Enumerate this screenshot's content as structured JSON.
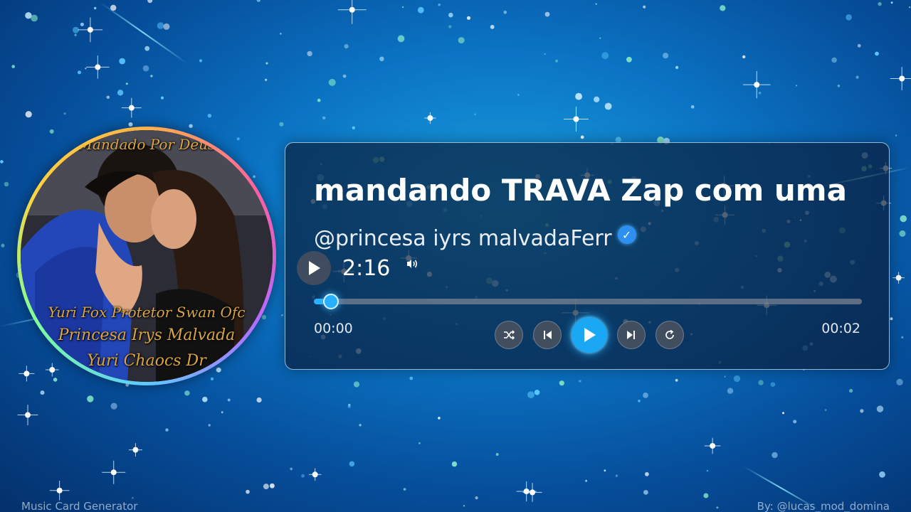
{
  "song": {
    "title": "mandando TRAVA Zap com uma ...",
    "artist": "@princesa iyrs malvadaFerr",
    "verified_icon": "verified-badge-icon",
    "duration": "2:16"
  },
  "player": {
    "current_time": "00:00",
    "total_time": "00:02",
    "progress": 0.02,
    "controls": [
      {
        "name": "shuffle-button",
        "icon": "shuffle-icon"
      },
      {
        "name": "previous-button",
        "icon": "skip-previous-icon"
      },
      {
        "name": "play-button",
        "icon": "play-icon"
      },
      {
        "name": "next-button",
        "icon": "skip-next-icon"
      },
      {
        "name": "repeat-button",
        "icon": "repeat-icon"
      }
    ],
    "accent_color": "#1aa8f5"
  },
  "cover": {
    "overlay_lines": [
      "Mandado Por Deus",
      "Yuri Fox Protetor Swan Ofc",
      "Princesa Irys Malvada",
      "Yuri Chaocs Dr"
    ]
  },
  "footer": {
    "left": "Music Card Generator",
    "right": "By: @lucas_mod_domina"
  }
}
